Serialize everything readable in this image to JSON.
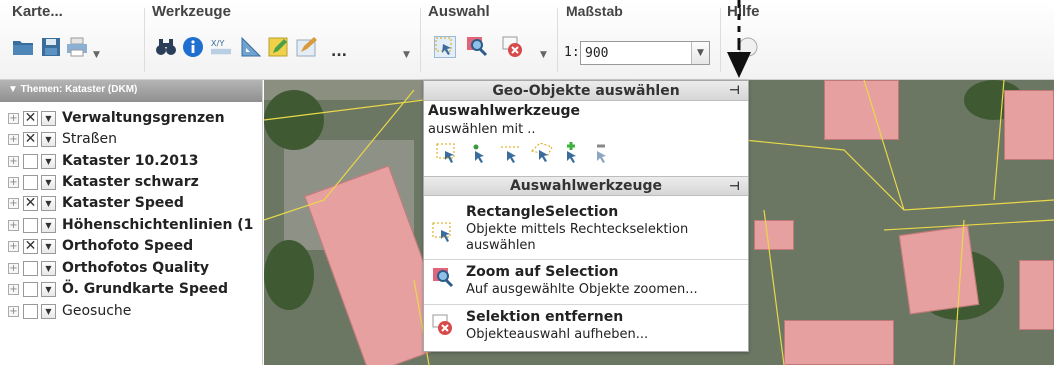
{
  "toolbar": {
    "groups": {
      "karte": "Karte...",
      "werkzeuge": "Werkzeuge",
      "auswahl": "Auswahl",
      "massstab": "Maßstab",
      "hilfe": "Hilfe"
    },
    "more_label": "...",
    "scale_prefix": "1:",
    "scale_value": "900"
  },
  "sidebar": {
    "header": "▼ Themen: Kataster (DKM)",
    "layers": [
      {
        "label": "Verwaltungsgrenzen",
        "checked": "✕",
        "bold": true
      },
      {
        "label": "Straßen",
        "checked": "✕",
        "bold": false
      },
      {
        "label": "Kataster 10.2013",
        "checked": "",
        "bold": true
      },
      {
        "label": "Kataster schwarz",
        "checked": "",
        "bold": true
      },
      {
        "label": "Kataster Speed",
        "checked": "✕",
        "bold": true
      },
      {
        "label": "Höhenschichtenlinien (1",
        "checked": "",
        "bold": true
      },
      {
        "label": "Orthofoto Speed",
        "checked": "✕",
        "bold": true
      },
      {
        "label": "Orthofotos Quality",
        "checked": "",
        "bold": true
      },
      {
        "label": "Ö. Grundkarte Speed",
        "checked": "",
        "bold": true
      },
      {
        "label": "Geosuche",
        "checked": "",
        "bold": false
      }
    ]
  },
  "popup": {
    "title": "Geo-Objekte auswählen",
    "section1_title": "Auswahlwerkzeuge",
    "section1_sub": "auswählen mit ..",
    "section2_title": "Auswahlwerkzeuge",
    "items": [
      {
        "title": "RectangleSelection",
        "desc": "Objekte mittels Rechteckselektion auswählen"
      },
      {
        "title": "Zoom auf Selection",
        "desc": "Auf ausgewählte Objekte zoomen..."
      },
      {
        "title": "Selektion entfernen",
        "desc": "Objekteauswahl aufheben..."
      }
    ]
  },
  "icons": {
    "open": "folder-icon",
    "save": "save-icon",
    "print": "printer-icon",
    "find": "binoculars-icon",
    "info": "info-icon",
    "xy": "xy-coordinate-icon",
    "measure": "measure-icon",
    "edit": "edit-icon",
    "draw": "draw-icon",
    "select": "selection-icon",
    "zoom_sel": "zoom-selection-icon",
    "remove_sel": "remove-selection-icon"
  },
  "colors": {
    "roof": "#e7a0a0",
    "parcel_line": "#e8d84a",
    "header": "#9e9e9e"
  }
}
